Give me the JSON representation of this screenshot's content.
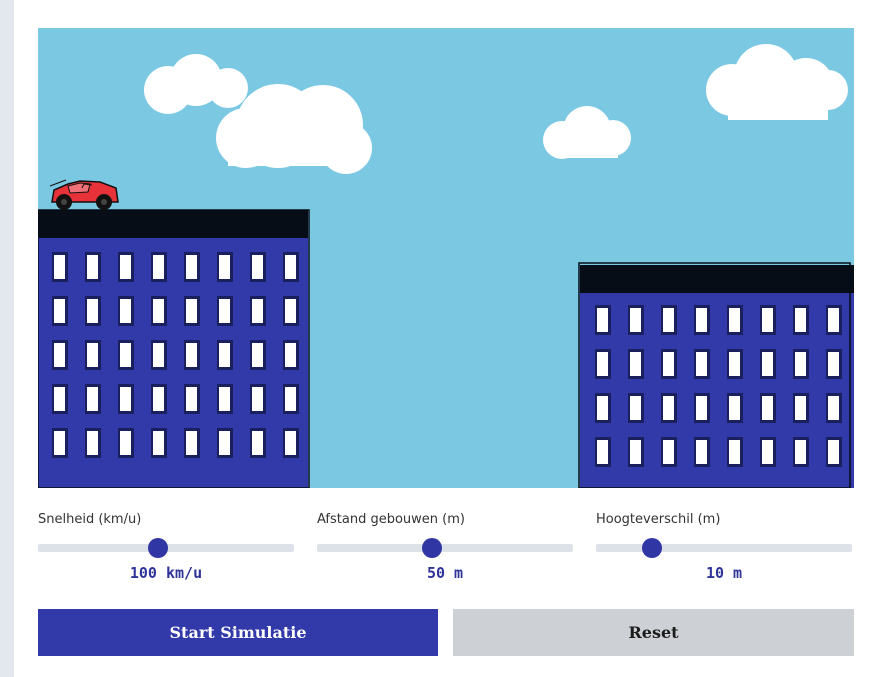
{
  "scene": {
    "sky_color": "#7ac8e2",
    "building_color": "#3239a8",
    "roof_color": "#070d17",
    "car_color": "#e8323a",
    "car_icon": "red-car-icon"
  },
  "controls": [
    {
      "label": "Snelheid (km/u)",
      "value": "100 km/u",
      "level_fraction": 0.47
    },
    {
      "label": "Afstand gebouwen (m)",
      "value": "50 m",
      "level_fraction": 0.45
    },
    {
      "label": "Hoogteverschil (m)",
      "value": "10 m",
      "level_fraction": 0.22
    }
  ],
  "buttons": {
    "start_label": "Start Simulatie",
    "reset_label": "Reset"
  },
  "colors": {
    "accent": "#3239a8",
    "reset_bg": "#cdd1d5",
    "value_text": "#2f3498"
  }
}
